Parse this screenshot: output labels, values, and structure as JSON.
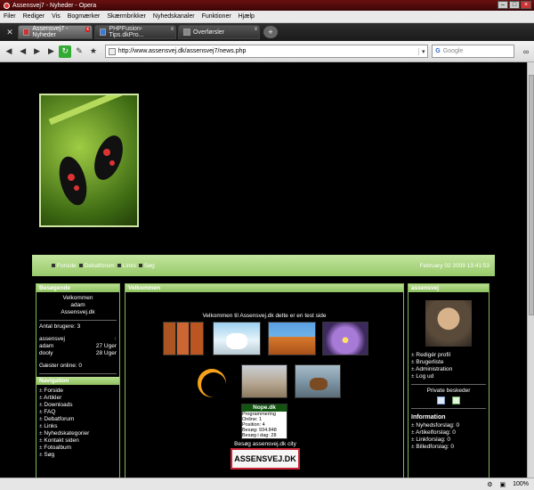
{
  "window": {
    "title": "Assensvej7 - Nyheder - Opera"
  },
  "menubar": {
    "items": [
      "Filer",
      "Rediger",
      "Vis",
      "Bogmærker",
      "Skærmbrikker",
      "Nyhedskanaler",
      "Funktioner",
      "Hjælp"
    ]
  },
  "tabs": [
    {
      "label": "Assensvej7 - Nyheder"
    },
    {
      "label": "PHPFusion-Tips.dkPro..."
    },
    {
      "label": "Overførsler"
    }
  ],
  "address": {
    "url": "http://www.assensvej.dk/assensvej7/news.php",
    "search_placeholder": "Google"
  },
  "nav": {
    "links": [
      "Forside",
      "Debatforum",
      "Links",
      "Søg"
    ],
    "date": "February 02 2009 13:41:53"
  },
  "left": {
    "status_title": "Besøgende",
    "welcome": "Velkommen",
    "user": "adam",
    "site": "Assensvej.dk",
    "users_count": "Antal brugere: 3",
    "members": [
      {
        "name": "assensvej",
        "when": ""
      },
      {
        "name": "adam",
        "when": "27 Uger"
      },
      {
        "name": "dooly",
        "when": "28 Uger"
      }
    ],
    "guests": "Gæster online: 0",
    "nav_title": "Navigation",
    "nav_items": [
      "Forside",
      "Artikler",
      "Downloads",
      "FAQ",
      "Debatforum",
      "Links",
      "Nyhedskategorier",
      "Kontakt siden",
      "Fotoalbum",
      "Søg"
    ]
  },
  "main": {
    "title": "Velkommen",
    "welcome_text": "Velkommen til Assensvej.dk dette er en test side",
    "nope_title": "Nope.dk",
    "nope_lines": [
      "Programmering",
      "Online:  1",
      "Position:  4",
      "Besøg:  934.848",
      "Besøg i dag:  28"
    ],
    "visit_text": "Besøg assensvej.dk city",
    "logo_text": "ASSENSVEJ.DK"
  },
  "right": {
    "title": "assensvej",
    "links": [
      "Redigér profil",
      "Brugerliste",
      "Administration",
      "Log ud"
    ],
    "pm_label": "Private beskeder",
    "info_title": "Information",
    "info_items": [
      "Nyhedsforslag: 0",
      "Artikelforslag: 0",
      "Linkforslag: 0",
      "Billedforslag: 0"
    ]
  },
  "status": {
    "zoom": "100%"
  }
}
